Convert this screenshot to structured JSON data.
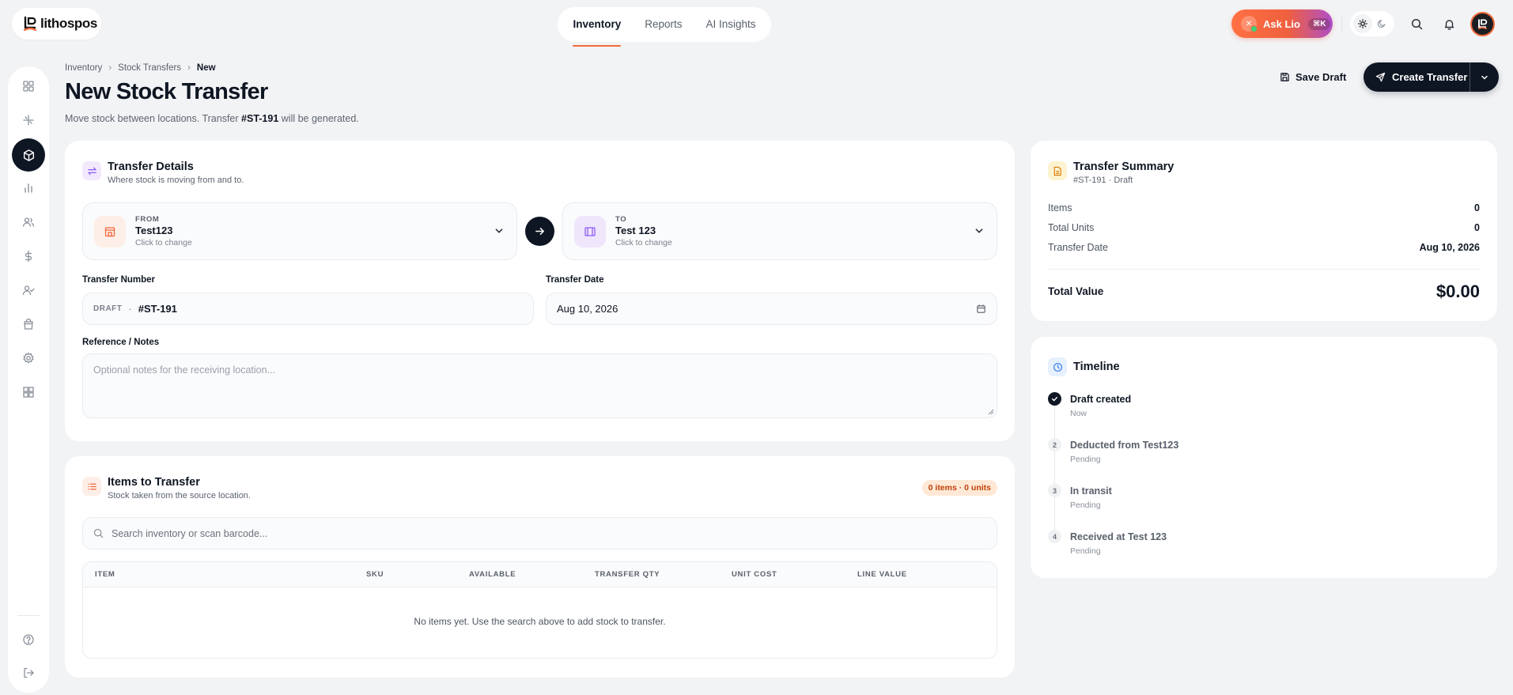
{
  "brand": {
    "name": "lithospos"
  },
  "topnav": [
    {
      "label": "Inventory",
      "active": true
    },
    {
      "label": "Reports",
      "active": false
    },
    {
      "label": "AI Insights",
      "active": false
    }
  ],
  "assistant": {
    "label": "Ask Lio",
    "shortcut": "⌘K"
  },
  "breadcrumb": [
    "Inventory",
    "Stock Transfers",
    "New"
  ],
  "page": {
    "title": "New Stock Transfer",
    "subtitle_pre": "Move stock between locations. Transfer ",
    "subtitle_number": "#ST-191",
    "subtitle_post": " will be generated."
  },
  "actions": {
    "save_draft": "Save Draft",
    "create": "Create Transfer"
  },
  "details": {
    "title": "Transfer Details",
    "subtitle": "Where stock is moving from and to.",
    "from": {
      "key": "FROM",
      "value": "Test123",
      "hint": "Click to change"
    },
    "to": {
      "key": "TO",
      "value": "Test 123",
      "hint": "Click to change"
    },
    "number_label": "Transfer Number",
    "number_tag": "DRAFT",
    "number_sep": "·",
    "number_value": "#ST-191",
    "date_label": "Transfer Date",
    "date_value": "Aug 10, 2026",
    "notes_label": "Reference / Notes",
    "notes_placeholder": "Optional notes for the receiving location..."
  },
  "items": {
    "title": "Items to Transfer",
    "subtitle": "Stock taken from the source location.",
    "badge": "0 items · 0 units",
    "search_placeholder": "Search inventory or scan barcode...",
    "columns": [
      "ITEM",
      "SKU",
      "AVAILABLE",
      "TRANSFER QTY",
      "UNIT COST",
      "LINE VALUE"
    ],
    "empty": "No items yet. Use the search above to add stock to transfer."
  },
  "summary": {
    "title": "Transfer Summary",
    "subtitle": "#ST-191 · Draft",
    "rows": [
      {
        "label": "Items",
        "value": "0"
      },
      {
        "label": "Total Units",
        "value": "0"
      },
      {
        "label": "Transfer Date",
        "value": "Aug 10, 2026"
      }
    ],
    "total_label": "Total Value",
    "total_value": "$0.00"
  },
  "timeline": {
    "title": "Timeline",
    "steps": [
      {
        "marker": "",
        "title": "Draft created",
        "status": "Now",
        "done": true
      },
      {
        "marker": "2",
        "title": "Deducted from Test123",
        "status": "Pending",
        "done": false
      },
      {
        "marker": "3",
        "title": "In transit",
        "status": "Pending",
        "done": false
      },
      {
        "marker": "4",
        "title": "Received at Test 123",
        "status": "Pending",
        "done": false
      }
    ]
  },
  "colors": {
    "accent": "#f26a3d",
    "dark": "#0f1623",
    "background": "#f2f3f5"
  },
  "icons": {
    "sidebar": [
      "grid-icon",
      "sparkle-icon",
      "box-icon",
      "chart-icon",
      "users-icon",
      "dollar-icon",
      "user-check-icon",
      "bag-icon",
      "settings-icon",
      "apps-icon",
      "help-icon",
      "logout-icon"
    ]
  }
}
